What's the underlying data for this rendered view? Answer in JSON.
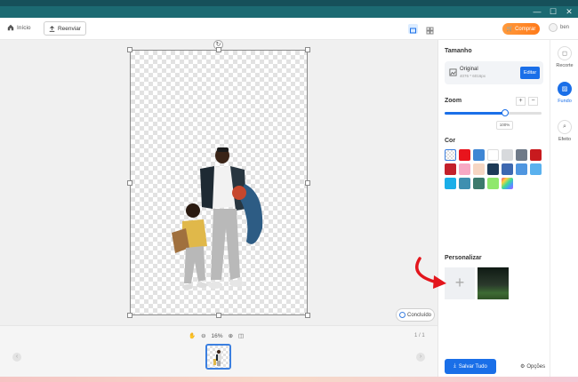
{
  "window": {
    "minimize": "—",
    "maximize": "☐",
    "close": "✕"
  },
  "toolbar": {
    "home_label": "Início",
    "reenviar_label": "Reenviar",
    "comprar_label": "Comprar",
    "user_name": "ben"
  },
  "canvas": {
    "rotate_glyph": "↻",
    "concluido_label": "Concluído"
  },
  "bottom": {
    "zoom_value": "16%",
    "page_count": "1 / 1",
    "prev_arrow": "‹",
    "next_arrow": "›"
  },
  "panel": {
    "tamanho_title": "Tamanho",
    "size_name": "Original",
    "size_dims": "4076 * 6016px",
    "editar_label": "Editar",
    "zoom_title": "Zoom",
    "zoom_plus": "+",
    "zoom_minus": "−",
    "zoom_percent": "100%",
    "zoom_level": 0.62,
    "cor_title": "Cor",
    "personalizar_title": "Personalizar",
    "add_glyph": "+",
    "salvar_label": "Salvar Tudo",
    "opcoes_label": "Opções",
    "colors": [
      "transparent",
      "#e8141c",
      "#3f86d4",
      "#ffffff",
      "#d7d9dc",
      "#6f7a89",
      "#c81a1e",
      "#c3202b",
      "#f7a9c4",
      "#f6d6c3",
      "#1d3a57",
      "#3d68b0",
      "#4f96e0",
      "#5ab1ee",
      "#1aaee8",
      "#3f8fb0",
      "#3c7a6c",
      "#8fe86c",
      "rainbow"
    ]
  },
  "sidebar": {
    "items": [
      {
        "label": "Recorte",
        "active": false
      },
      {
        "label": "Fundo",
        "active": true
      },
      {
        "label": "Efeito",
        "active": false
      }
    ]
  }
}
